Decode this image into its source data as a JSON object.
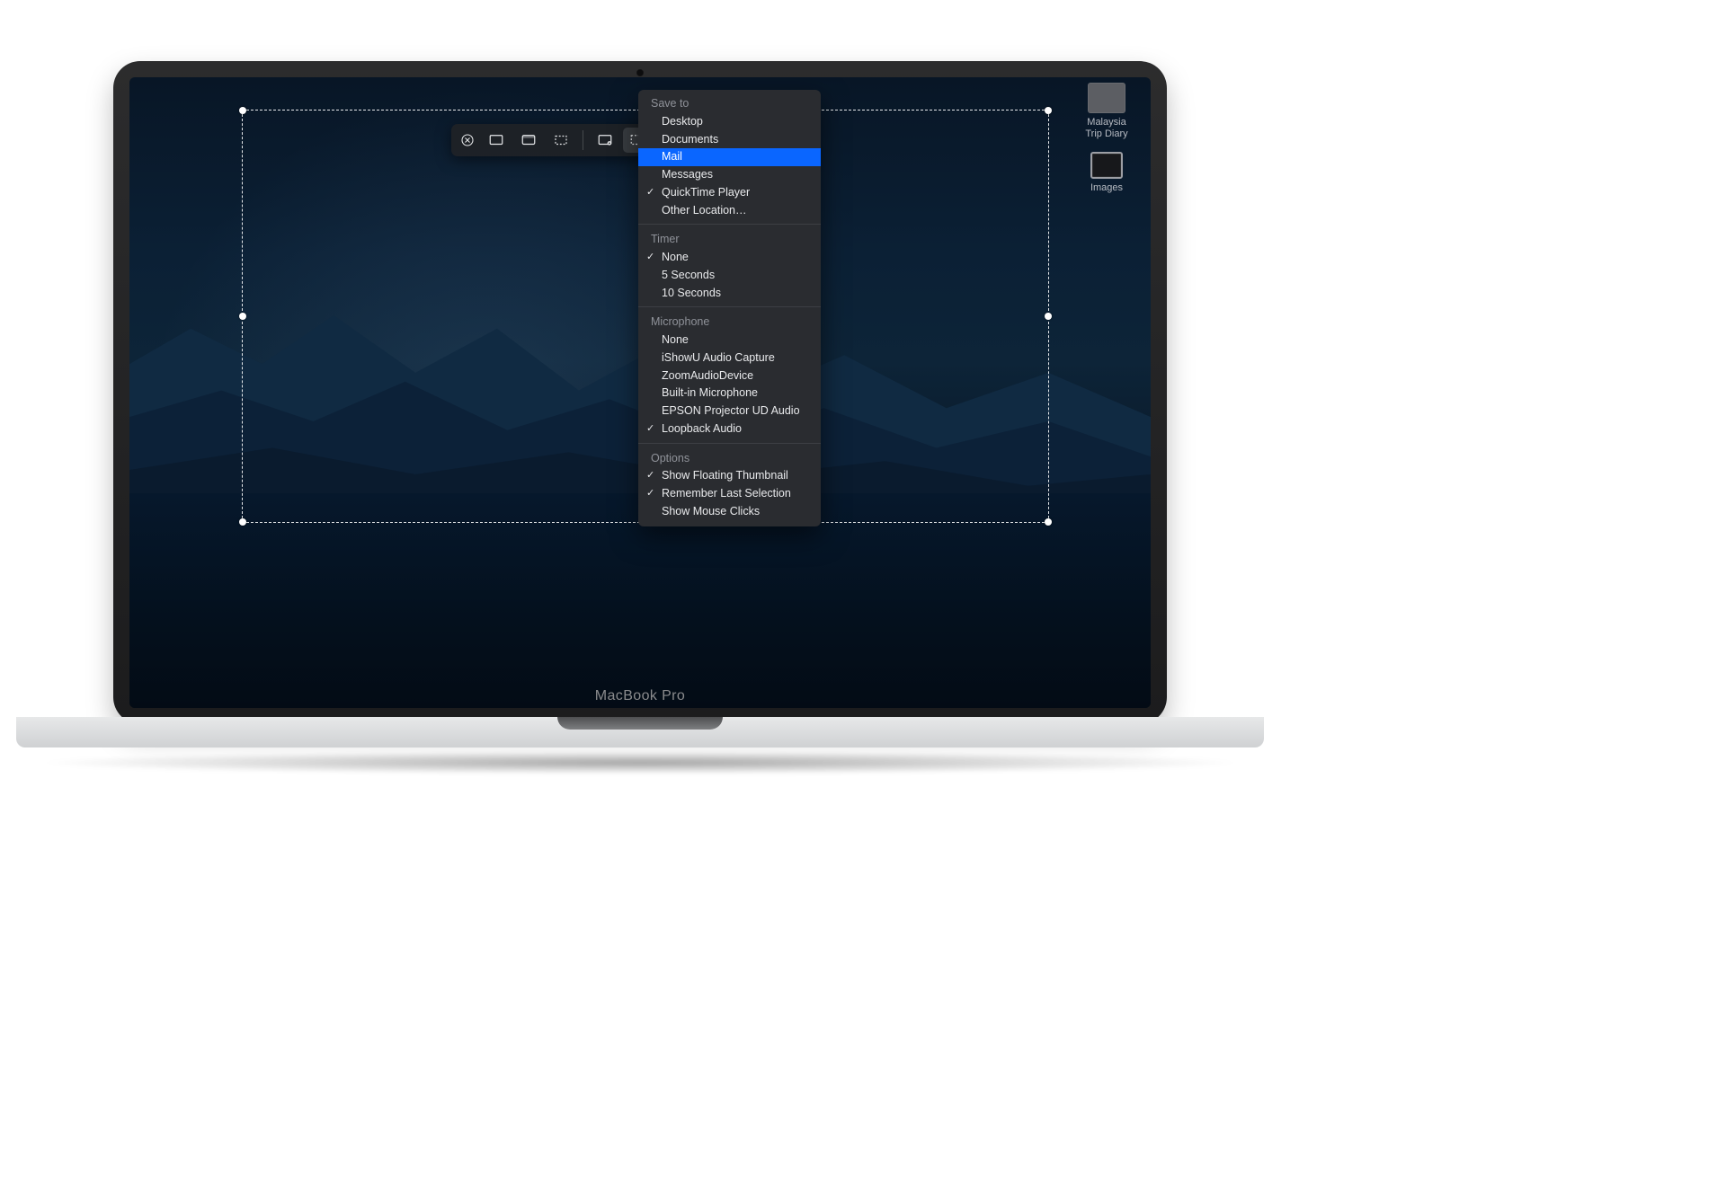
{
  "device": {
    "model_label": "MacBook Pro"
  },
  "desktop_icons": [
    {
      "label": "Malaysia\nTrip Diary"
    },
    {
      "label": "Images"
    }
  ],
  "toolbar": {
    "close": "×",
    "buttons": [
      {
        "name": "capture-entire-screen",
        "active": false
      },
      {
        "name": "capture-selected-window",
        "active": false
      },
      {
        "name": "capture-selected-portion",
        "active": false
      },
      {
        "name": "record-entire-screen",
        "active": false
      },
      {
        "name": "record-selected-portion",
        "active": true
      }
    ]
  },
  "menu": {
    "sections": [
      {
        "header": "Save to",
        "items": [
          {
            "label": "Desktop",
            "checked": false,
            "highlight": false
          },
          {
            "label": "Documents",
            "checked": false,
            "highlight": false
          },
          {
            "label": "Mail",
            "checked": false,
            "highlight": true
          },
          {
            "label": "Messages",
            "checked": false,
            "highlight": false
          },
          {
            "label": "QuickTime Player",
            "checked": true,
            "highlight": false
          },
          {
            "label": "Other Location…",
            "checked": false,
            "highlight": false
          }
        ]
      },
      {
        "header": "Timer",
        "items": [
          {
            "label": "None",
            "checked": true,
            "highlight": false
          },
          {
            "label": "5 Seconds",
            "checked": false,
            "highlight": false
          },
          {
            "label": "10 Seconds",
            "checked": false,
            "highlight": false
          }
        ]
      },
      {
        "header": "Microphone",
        "items": [
          {
            "label": "None",
            "checked": false,
            "highlight": false
          },
          {
            "label": "iShowU Audio Capture",
            "checked": false,
            "highlight": false
          },
          {
            "label": "ZoomAudioDevice",
            "checked": false,
            "highlight": false
          },
          {
            "label": "Built-in Microphone",
            "checked": false,
            "highlight": false
          },
          {
            "label": "EPSON Projector UD Audio",
            "checked": false,
            "highlight": false
          },
          {
            "label": "Loopback Audio",
            "checked": true,
            "highlight": false
          }
        ]
      },
      {
        "header": "Options",
        "items": [
          {
            "label": "Show Floating Thumbnail",
            "checked": true,
            "highlight": false
          },
          {
            "label": "Remember Last Selection",
            "checked": true,
            "highlight": false
          },
          {
            "label": "Show Mouse Clicks",
            "checked": false,
            "highlight": false
          }
        ]
      }
    ]
  }
}
